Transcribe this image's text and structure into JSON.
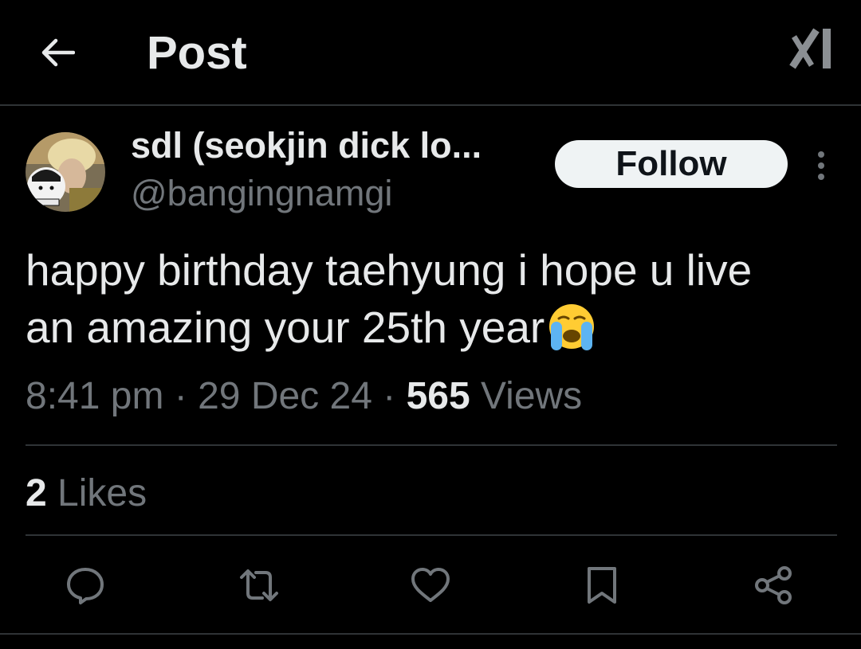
{
  "header": {
    "title": "Post",
    "back_icon": "arrow-left-icon",
    "logo_icon": "x-logo-icon"
  },
  "author": {
    "display_name": "sdl (seokjin dick lo...",
    "handle": "@bangingnamgi",
    "follow_label": "Follow",
    "more_icon": "more-vertical-icon"
  },
  "post": {
    "text_line1": "happy birthday taehyung i hope u live",
    "text_line2": "an amazing your 25th year",
    "emoji": "loudly-crying-face-emoji",
    "time": "8:41 pm",
    "date": "29 Dec 24",
    "separator": " · ",
    "views_count": "565",
    "views_label": "Views"
  },
  "engagement": {
    "likes_count": "2",
    "likes_label": "Likes"
  },
  "actions": [
    {
      "name": "reply",
      "icon": "reply-icon"
    },
    {
      "name": "repost",
      "icon": "repost-icon"
    },
    {
      "name": "like",
      "icon": "heart-icon"
    },
    {
      "name": "bookmark",
      "icon": "bookmark-icon"
    },
    {
      "name": "share",
      "icon": "share-icon"
    }
  ],
  "colors": {
    "background": "#000000",
    "primary_text": "#e7e9ea",
    "secondary_text": "#71767b",
    "divider": "#2f3336",
    "follow_bg": "#eff3f4",
    "icon": "#71767b"
  }
}
